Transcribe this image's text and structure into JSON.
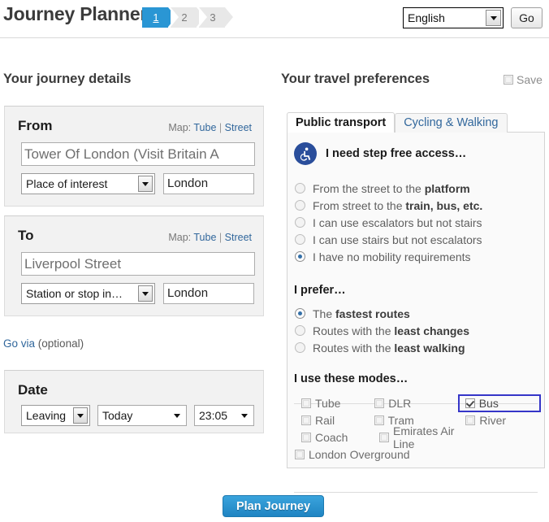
{
  "header": {
    "app_title": "Journey Planner",
    "steps": [
      {
        "label": "1",
        "active": true
      },
      {
        "label": "2",
        "active": false
      },
      {
        "label": "3",
        "active": false
      }
    ],
    "language_value": "English",
    "go_label": "Go"
  },
  "left": {
    "section_title": "Your journey details",
    "from": {
      "heading": "From",
      "map_label": "Map:",
      "map_tube": "Tube",
      "map_sep": "|",
      "map_street": "Street",
      "location_value": "Tower Of London (Visit Britain A",
      "type_value": "Place of interest",
      "city_value": "London"
    },
    "to": {
      "heading": "To",
      "map_label": "Map:",
      "map_tube": "Tube",
      "map_sep": "|",
      "map_street": "Street",
      "location_value": "Liverpool Street",
      "type_value": "Station or stop in…",
      "city_value": "London"
    },
    "go_via_link": "Go via",
    "go_via_optional": "(optional)",
    "date": {
      "heading": "Date",
      "mode_value": "Leaving",
      "day_value": "Today",
      "time_value": "23:05"
    }
  },
  "right": {
    "section_title": "Your travel preferences",
    "save_label": "Save",
    "save_checked": false,
    "tabs": [
      {
        "label": "Public transport",
        "active": true
      },
      {
        "label": "Cycling & Walking",
        "active": false
      }
    ],
    "step_free": {
      "heading": "I need step free access…",
      "icon": "wheelchair-icon",
      "options": [
        {
          "text_normal": "From the street to the ",
          "text_bold": "platform",
          "checked": false
        },
        {
          "text_normal": "From street to the ",
          "text_bold": "train, bus, etc.",
          "checked": false
        },
        {
          "text_normal": "I can use escalators but not stairs",
          "text_bold": "",
          "checked": false
        },
        {
          "text_normal": "I can use stairs but not escalators",
          "text_bold": "",
          "checked": false
        },
        {
          "text_normal": "I have no mobility requirements",
          "text_bold": "",
          "checked": true
        }
      ]
    },
    "prefer": {
      "heading": "I prefer…",
      "options": [
        {
          "text_normal": "The ",
          "text_bold": "fastest routes",
          "checked": true
        },
        {
          "text_normal": "Routes with the ",
          "text_bold": "least changes",
          "checked": false
        },
        {
          "text_normal": "Routes with the ",
          "text_bold": "least walking",
          "checked": false
        }
      ]
    },
    "modes": {
      "heading": "I use these modes…",
      "rows": [
        [
          {
            "label": "Tube",
            "checked": false,
            "focused": false
          },
          {
            "label": "DLR",
            "checked": false,
            "focused": false
          },
          {
            "label": "Bus",
            "checked": true,
            "focused": true
          }
        ],
        [
          {
            "label": "Rail",
            "checked": false,
            "focused": false
          },
          {
            "label": "Tram",
            "checked": false,
            "focused": false
          },
          {
            "label": "River",
            "checked": false,
            "focused": false
          }
        ],
        [
          {
            "label": "Coach",
            "checked": false,
            "focused": false
          },
          {
            "label": "Emirates Air Line",
            "checked": false,
            "focused": false
          }
        ],
        [
          {
            "label": "London Overground",
            "checked": false,
            "focused": false
          }
        ]
      ]
    }
  },
  "footer": {
    "plan_label": "Plan Journey"
  },
  "colors": {
    "accent_blue": "#2a96d4",
    "link_blue": "#31679c",
    "focus_blue": "#3535c8",
    "radio_dot": "#3470a8",
    "wheelchair_badge": "#2a4e9b",
    "panel_bg": "#f2f2f2"
  }
}
